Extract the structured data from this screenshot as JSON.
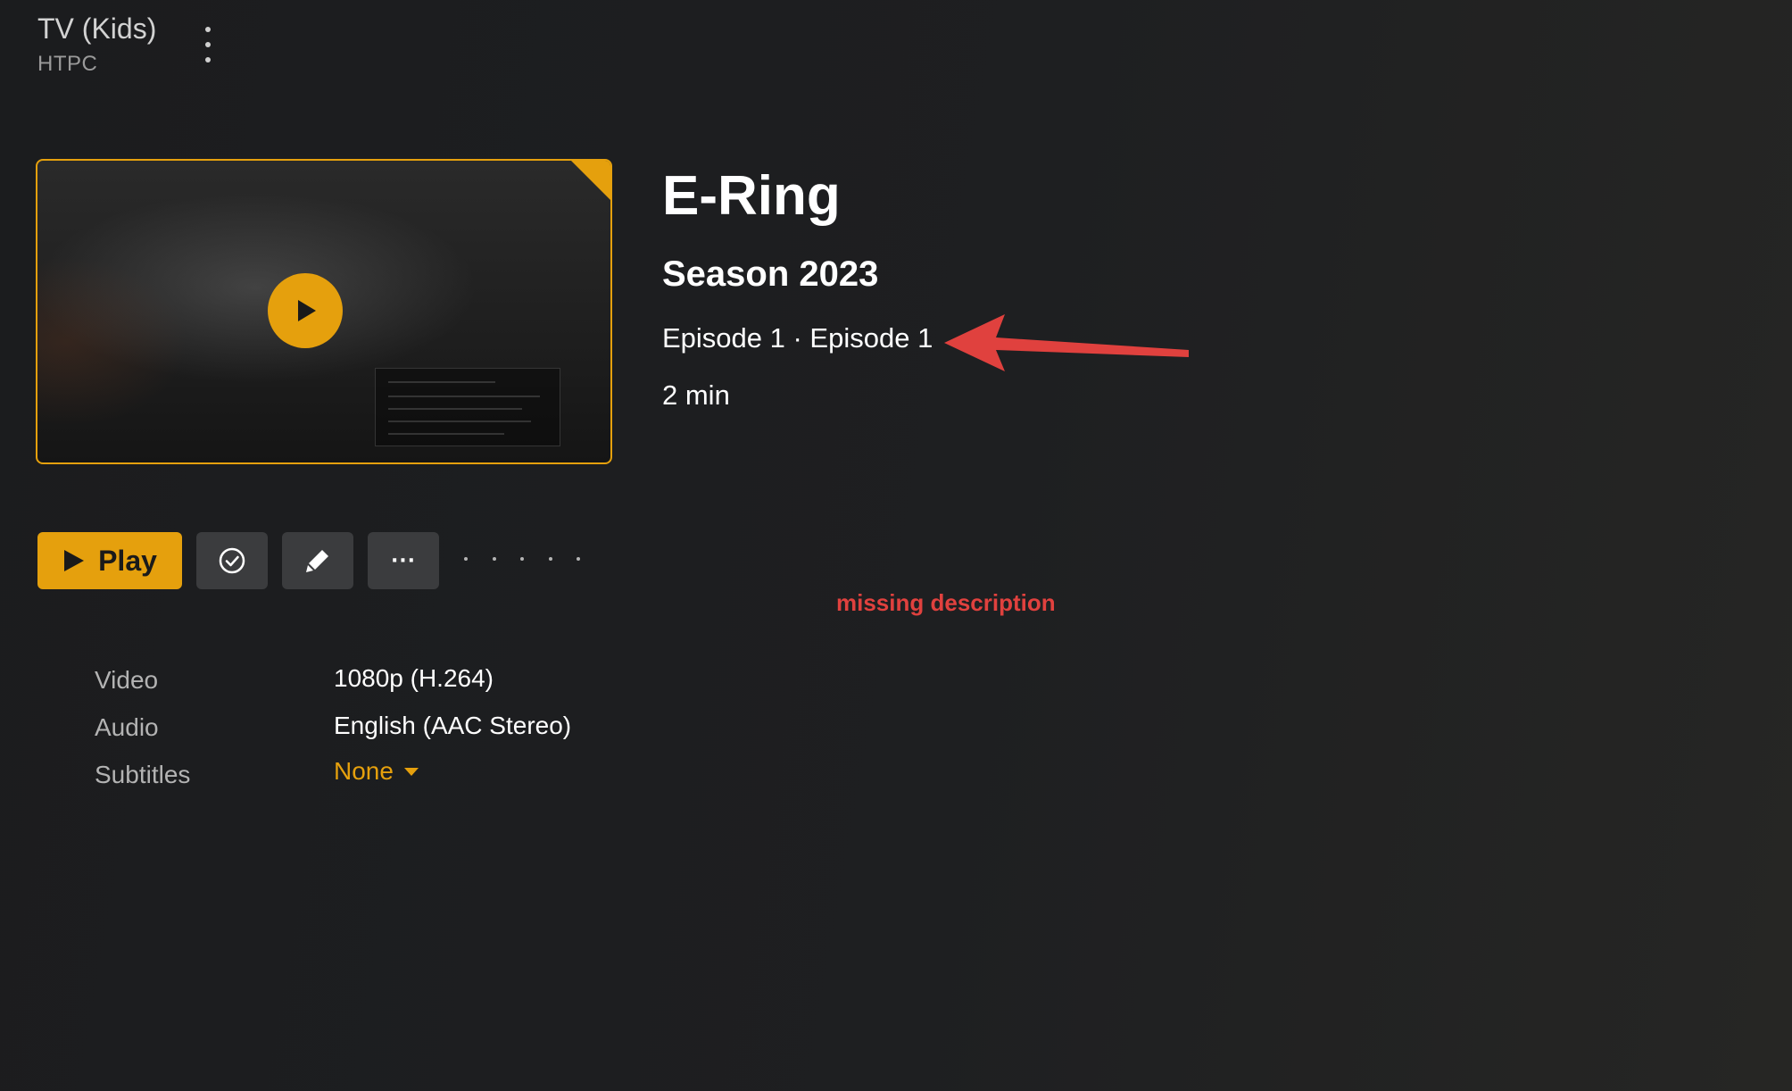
{
  "header": {
    "library_name": "TV (Kids)",
    "server_name": "HTPC",
    "menu_icon": "kebab-menu-icon"
  },
  "item": {
    "show_title": "E-Ring",
    "season": "Season 2023",
    "episode": "Episode 1 · Episode 1",
    "duration": "2 min"
  },
  "actions": {
    "play_label": "Play",
    "play_icon": "play-icon",
    "watched_icon": "check-circle-icon",
    "edit_icon": "pencil-icon",
    "more_label": "···"
  },
  "annotation": {
    "note": "missing description",
    "color": "#e0413e"
  },
  "media_info": {
    "video_label": "Video",
    "video_value": "1080p (H.264)",
    "audio_label": "Audio",
    "audio_value": "English (AAC Stereo)",
    "subtitles_label": "Subtitles",
    "subtitles_value": "None"
  },
  "colors": {
    "accent": "#e5a00d",
    "background": "#1e1f21",
    "button": "#3b3c3e"
  }
}
